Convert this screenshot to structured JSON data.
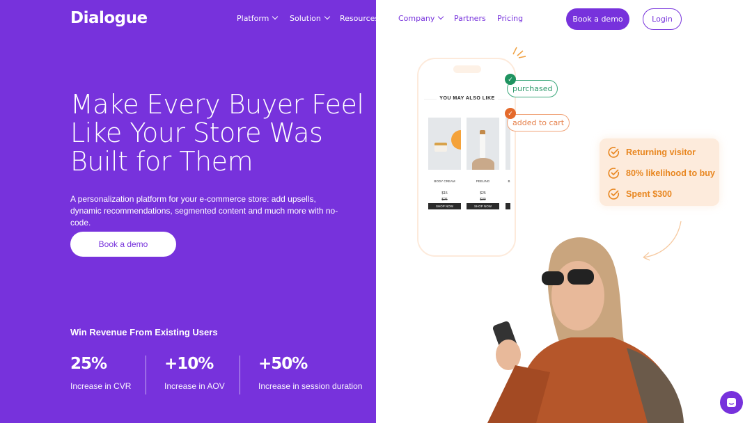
{
  "brand": {
    "logo": "Dialogue",
    "accent": "#7732dc"
  },
  "nav": {
    "items": [
      {
        "label": "Platform",
        "dropdown": true
      },
      {
        "label": "Solution",
        "dropdown": true
      },
      {
        "label": "Resources",
        "dropdown": false
      },
      {
        "label": "Company",
        "dropdown": true
      },
      {
        "label": "Partners",
        "dropdown": false
      },
      {
        "label": "Pricing",
        "dropdown": false
      }
    ],
    "book_demo": "Book a demo",
    "login": "Login"
  },
  "hero": {
    "title": "Make Every Buyer Feel Like Your Store Was Built for Them",
    "subtitle": "A personalization platform for your e-commerce store: add upsells, dynamic recommendations, segmented content and much more with no-code.",
    "cta": "Book a demo"
  },
  "stats": {
    "heading": "Win Revenue From Existing Users",
    "items": [
      {
        "value": "25%",
        "label": "Increase in CVR"
      },
      {
        "value": "+10%",
        "label": "Increase in AOV"
      },
      {
        "value": "+50%",
        "label": "Increase in session duration"
      }
    ]
  },
  "phone": {
    "heading": "YOU MAY ALSO LIKE",
    "products": [
      {
        "name": "BODY CREAM",
        "price": "$15",
        "old_price": "$26",
        "button": "SHOP NOW"
      },
      {
        "name": "PEELING",
        "price": "$25",
        "old_price": "$30",
        "button": "SHOP NOW"
      },
      {
        "name": "B"
      }
    ],
    "tags": {
      "purchased": "purchased",
      "added": "added to cart"
    }
  },
  "visitor_card": {
    "items": [
      "Returning visitor",
      "80% likelihood to buy",
      "Spent $300"
    ]
  },
  "chat": {
    "icon": "chat-icon"
  }
}
